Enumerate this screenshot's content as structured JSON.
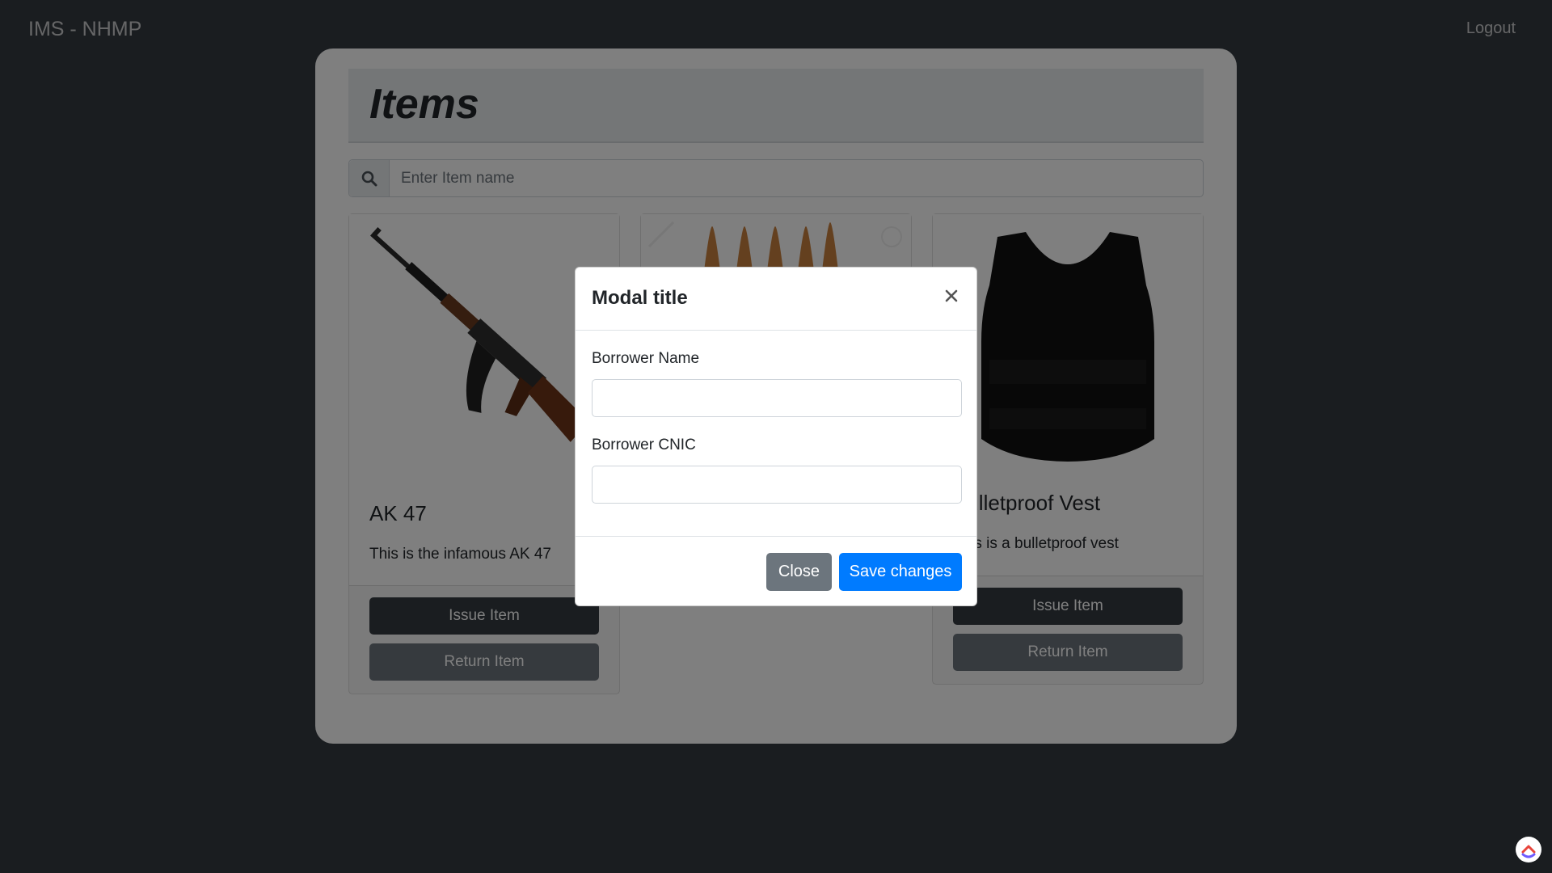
{
  "navbar": {
    "brand": "IMS - NHMP",
    "logout": "Logout"
  },
  "page": {
    "title": "Items",
    "search": {
      "placeholder": "Enter Item name",
      "value": ""
    }
  },
  "items": [
    {
      "title": "AK 47",
      "description": "This is the infamous AK 47",
      "issue_label": "Issue Item",
      "return_label": "Return Item",
      "image": "rifle-image"
    },
    {
      "title": "",
      "description": "",
      "issue_label": "",
      "return_label": "",
      "image": "bullets-image"
    },
    {
      "title": "Bulletproof Vest",
      "description": "This is a bulletproof vest",
      "issue_label": "Issue Item",
      "return_label": "Return Item",
      "image": "vest-image"
    }
  ],
  "modal": {
    "title": "Modal title",
    "fields": [
      {
        "label": "Borrower Name",
        "value": ""
      },
      {
        "label": "Borrower CNIC",
        "value": ""
      }
    ],
    "close_label": "Close",
    "save_label": "Save changes"
  },
  "colors": {
    "page_bg": "#343a40",
    "primary": "#007bff",
    "secondary": "#6c757d",
    "dark": "#343a40"
  }
}
